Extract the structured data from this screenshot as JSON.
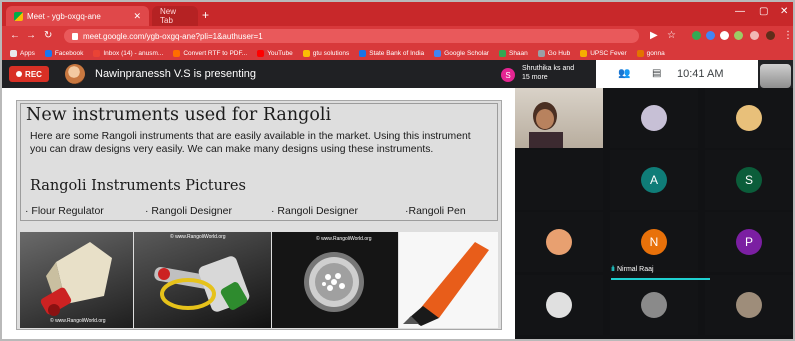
{
  "browser": {
    "active_tab_title": "Meet - ygb-oxgq-ane",
    "other_tab_title": "New Tab",
    "url": "meet.google.com/ygb-oxgq-ane?pli=1&authuser=1",
    "bookmarks": [
      {
        "label": "Apps",
        "color": "#e8eaed"
      },
      {
        "label": "Facebook",
        "color": "#1877f2"
      },
      {
        "label": "Inbox (14) - anusm...",
        "color": "#ea4335"
      },
      {
        "label": "Convert RTF to PDF...",
        "color": "#ff6d00"
      },
      {
        "label": "YouTube",
        "color": "#ff0000"
      },
      {
        "label": "gtu solutions",
        "color": "#fbbc04"
      },
      {
        "label": "State Bank of India",
        "color": "#1a73e8"
      },
      {
        "label": "Google Scholar",
        "color": "#4285f4"
      },
      {
        "label": "Shaan",
        "color": "#34a853"
      },
      {
        "label": "Go Hub",
        "color": "#9aa0a6"
      },
      {
        "label": "UPSC Fever",
        "color": "#f6ad00"
      },
      {
        "label": "gonna",
        "color": "#e37400"
      }
    ]
  },
  "meet": {
    "rec_label": "REC",
    "presenter_text": "Nawinpranessh V.S is presenting",
    "participants_avatar_letter": "S",
    "participants_text": "Shruthika ks and 15 more",
    "clock": "10:41 AM",
    "accent_color": "#1fd0d0"
  },
  "slide": {
    "title": "New instruments used for Rangoli",
    "body": "Here are some Rangoli instruments that are easily available in the market. Using this instrument you can draw designs very easily. We can make many designs using these instruments.",
    "subtitle": "Rangoli Instruments Pictures",
    "captions": [
      "Flour Regulator",
      "Rangoli Designer",
      "Rangoli Designer",
      "Rangoli Pen"
    ],
    "watermarks": [
      "© www.RangoliWorld.org",
      "© www.RangoliWorld.org",
      "© www.RangoliWorld.org"
    ]
  },
  "participants": [
    {
      "kind": "video"
    },
    {
      "kind": "photo",
      "color": "#c7c0d6"
    },
    {
      "kind": "photo",
      "color": "#e8c07a"
    },
    {
      "kind": "empty"
    },
    {
      "kind": "letter",
      "letter": "A",
      "color": "#0f7d78"
    },
    {
      "kind": "letter",
      "letter": "S",
      "color": "#0b5d3a"
    },
    {
      "kind": "photo",
      "color": "#e8a070"
    },
    {
      "kind": "letter",
      "letter": "N",
      "color": "#e8710a",
      "name": "Nirmal Raaj",
      "speaking": true
    },
    {
      "kind": "letter",
      "letter": "P",
      "color": "#7b1fa2"
    },
    {
      "kind": "photo",
      "color": "#e0e0e0"
    },
    {
      "kind": "photo",
      "color": "#8a8a8a"
    },
    {
      "kind": "photo",
      "color": "#9e8d7a"
    }
  ]
}
